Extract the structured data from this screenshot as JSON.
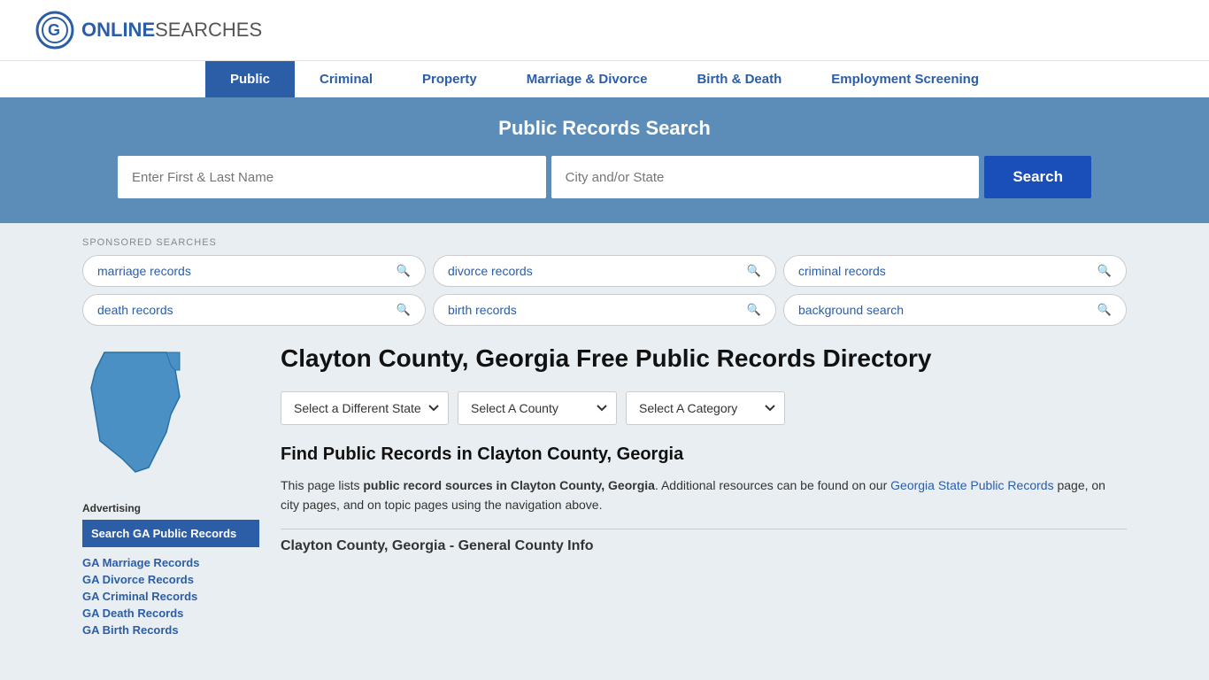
{
  "logo": {
    "text_online": "ONLINE",
    "text_searches": "SEARCHES"
  },
  "nav": {
    "items": [
      {
        "label": "Public",
        "active": true
      },
      {
        "label": "Criminal",
        "active": false
      },
      {
        "label": "Property",
        "active": false
      },
      {
        "label": "Marriage & Divorce",
        "active": false
      },
      {
        "label": "Birth & Death",
        "active": false
      },
      {
        "label": "Employment Screening",
        "active": false
      }
    ]
  },
  "search_banner": {
    "title": "Public Records Search",
    "name_placeholder": "Enter First & Last Name",
    "city_placeholder": "City and/or State",
    "button_label": "Search"
  },
  "sponsored": {
    "label": "SPONSORED SEARCHES",
    "pills": [
      {
        "text": "marriage records"
      },
      {
        "text": "divorce records"
      },
      {
        "text": "criminal records"
      },
      {
        "text": "death records"
      },
      {
        "text": "birth records"
      },
      {
        "text": "background search"
      }
    ]
  },
  "page_title": "Clayton County, Georgia Free Public Records Directory",
  "dropdowns": {
    "state_label": "Select a Different State",
    "county_label": "Select A County",
    "category_label": "Select A Category"
  },
  "find_records": {
    "title": "Find Public Records in Clayton County, Georgia",
    "desc_part1": "This page lists ",
    "desc_bold": "public record sources in Clayton County, Georgia",
    "desc_part2": ". Additional resources can be found on our ",
    "desc_link": "Georgia State Public Records",
    "desc_part3": " page, on city pages, and on topic pages using the navigation above."
  },
  "county_info_title": "Clayton County, Georgia - General County Info",
  "sidebar": {
    "ad_label": "Advertising",
    "featured_label": "Search GA Public Records",
    "links": [
      "GA Marriage Records",
      "GA Divorce Records",
      "GA Criminal Records",
      "GA Death Records",
      "GA Birth Records"
    ]
  }
}
